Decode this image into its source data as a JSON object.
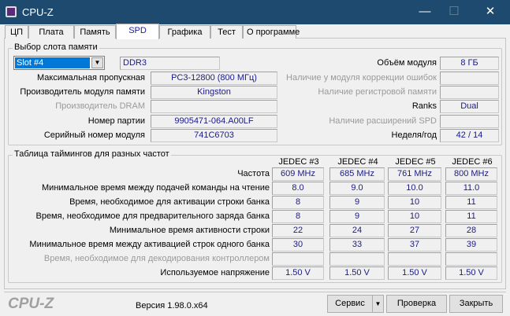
{
  "window": {
    "title": "CPU-Z",
    "minimize": "—",
    "maximize": "☐",
    "close": "✕"
  },
  "tabs": [
    {
      "label": "ЦП"
    },
    {
      "label": "Плата"
    },
    {
      "label": "Память"
    },
    {
      "label": "SPD"
    },
    {
      "label": "Графика"
    },
    {
      "label": "Тест"
    },
    {
      "label": "О программе"
    }
  ],
  "slot": {
    "group_label": "Выбор слота памяти",
    "selected": "Slot #4",
    "type": "DDR3",
    "left_rows": [
      {
        "label": "Максимальная пропускная",
        "value": "PC3-12800 (800 МГц)",
        "disabled": false
      },
      {
        "label": "Производитель модуля памяти",
        "value": "Kingston",
        "disabled": false
      },
      {
        "label": "Производитель DRAM",
        "value": "",
        "disabled": true
      },
      {
        "label": "Номер партии",
        "value": "9905471-064.A00LF",
        "disabled": false
      },
      {
        "label": "Серийный номер модуля",
        "value": "741C6703",
        "disabled": false
      }
    ],
    "right_rows": [
      {
        "label": "Объём модуля",
        "value": "8 ГБ",
        "disabled": false
      },
      {
        "label": "Наличие у модуля коррекции ошибок",
        "value": "",
        "disabled": true
      },
      {
        "label": "Наличие регистровой памяти",
        "value": "",
        "disabled": true
      },
      {
        "label": "Ranks",
        "value": "Dual",
        "disabled": false
      },
      {
        "label": "Наличие расширений SPD",
        "value": "",
        "disabled": true
      },
      {
        "label": "Неделя/год",
        "value": "42 / 14",
        "disabled": false
      }
    ]
  },
  "timings": {
    "group_label": "Таблица таймингов для разных частот",
    "columns": [
      "JEDEC #3",
      "JEDEC #4",
      "JEDEC #5",
      "JEDEC #6"
    ],
    "rows": [
      {
        "label": "Частота",
        "values": [
          "609 MHz",
          "685 MHz",
          "761 MHz",
          "800 MHz"
        ],
        "disabled": false
      },
      {
        "label": "Минимальное время между подачей команды на чтение",
        "values": [
          "8.0",
          "9.0",
          "10.0",
          "11.0"
        ],
        "disabled": false
      },
      {
        "label": "Время, необходимое для активации строки банка",
        "values": [
          "8",
          "9",
          "10",
          "11"
        ],
        "disabled": false
      },
      {
        "label": "Время, необходимое для предварительного заряда банка",
        "values": [
          "8",
          "9",
          "10",
          "11"
        ],
        "disabled": false
      },
      {
        "label": "Минимальное время активности строки",
        "values": [
          "22",
          "24",
          "27",
          "28"
        ],
        "disabled": false
      },
      {
        "label": "Минимальное время между активацией строк одного банка",
        "values": [
          "30",
          "33",
          "37",
          "39"
        ],
        "disabled": false
      },
      {
        "label": "Время, необходимое для декодирования контроллером",
        "values": [
          "",
          "",
          "",
          ""
        ],
        "disabled": true
      },
      {
        "label": "Используемое напряжение",
        "values": [
          "1.50 V",
          "1.50 V",
          "1.50 V",
          "1.50 V"
        ],
        "disabled": false
      }
    ]
  },
  "footer": {
    "logo": "CPU-Z",
    "version": "Версия 1.98.0.x64",
    "service": "Сервис",
    "validate": "Проверка",
    "close": "Закрыть"
  }
}
